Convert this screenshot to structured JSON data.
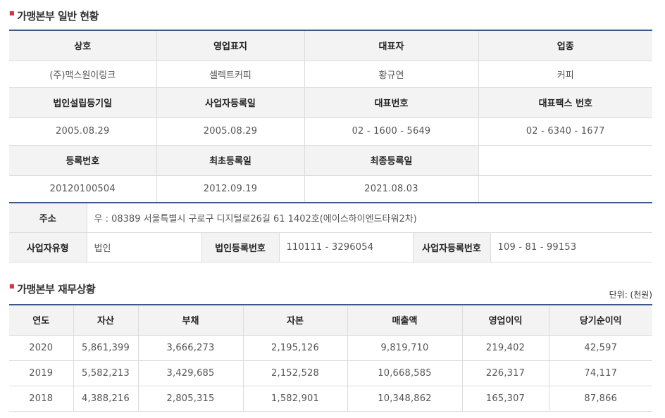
{
  "overview": {
    "title": "가맹본부 일반 현황",
    "rows": [
      {
        "headers": [
          "상호",
          "영업표지",
          "대표자",
          "업종"
        ],
        "values": [
          "(주)맥스원이링크",
          "셀렉트커피",
          "황규연",
          "커피"
        ]
      },
      {
        "headers": [
          "법인설립등기일",
          "사업자등록일",
          "대표번호",
          "대표팩스 번호"
        ],
        "values": [
          "2005.08.29",
          "2005.08.29",
          "02 - 1600 - 5649",
          "02 - 6340 - 1677"
        ]
      },
      {
        "headers": [
          "등록번호",
          "최초등록일",
          "최종등록일",
          ""
        ],
        "values": [
          "20120100504",
          "2012.09.19",
          "2021.08.03",
          ""
        ]
      }
    ]
  },
  "address": {
    "label": "주소",
    "value": "우 : 08389 서울특별시 구로구 디지털로26길 61 1402호(에이스하이엔드타워2차)",
    "biz_type_label": "사업자유형",
    "biz_type_value": "법인",
    "corp_reg_label": "법인등록번호",
    "corp_reg_value": "110111 - 3296054",
    "biz_reg_label": "사업자등록번호",
    "biz_reg_value": "109 - 81 - 99153"
  },
  "finance": {
    "title": "가맹본부 재무상황",
    "unit": "단위: (천원)",
    "headers": [
      "연도",
      "자산",
      "부채",
      "자본",
      "매출액",
      "영업이익",
      "당기순이익"
    ],
    "rows": [
      [
        "2020",
        "5,861,399",
        "3,666,273",
        "2,195,126",
        "9,819,710",
        "219,402",
        "42,597"
      ],
      [
        "2019",
        "5,582,213",
        "3,429,685",
        "2,152,528",
        "10,668,585",
        "226,317",
        "74,117"
      ],
      [
        "2018",
        "4,388,216",
        "2,805,315",
        "1,582,901",
        "10,348,862",
        "165,307",
        "87,866"
      ]
    ]
  },
  "colors": {
    "accent_border": "#3b5a88",
    "bullet": "#d8343e",
    "header_bg": "#f3f3f3"
  }
}
